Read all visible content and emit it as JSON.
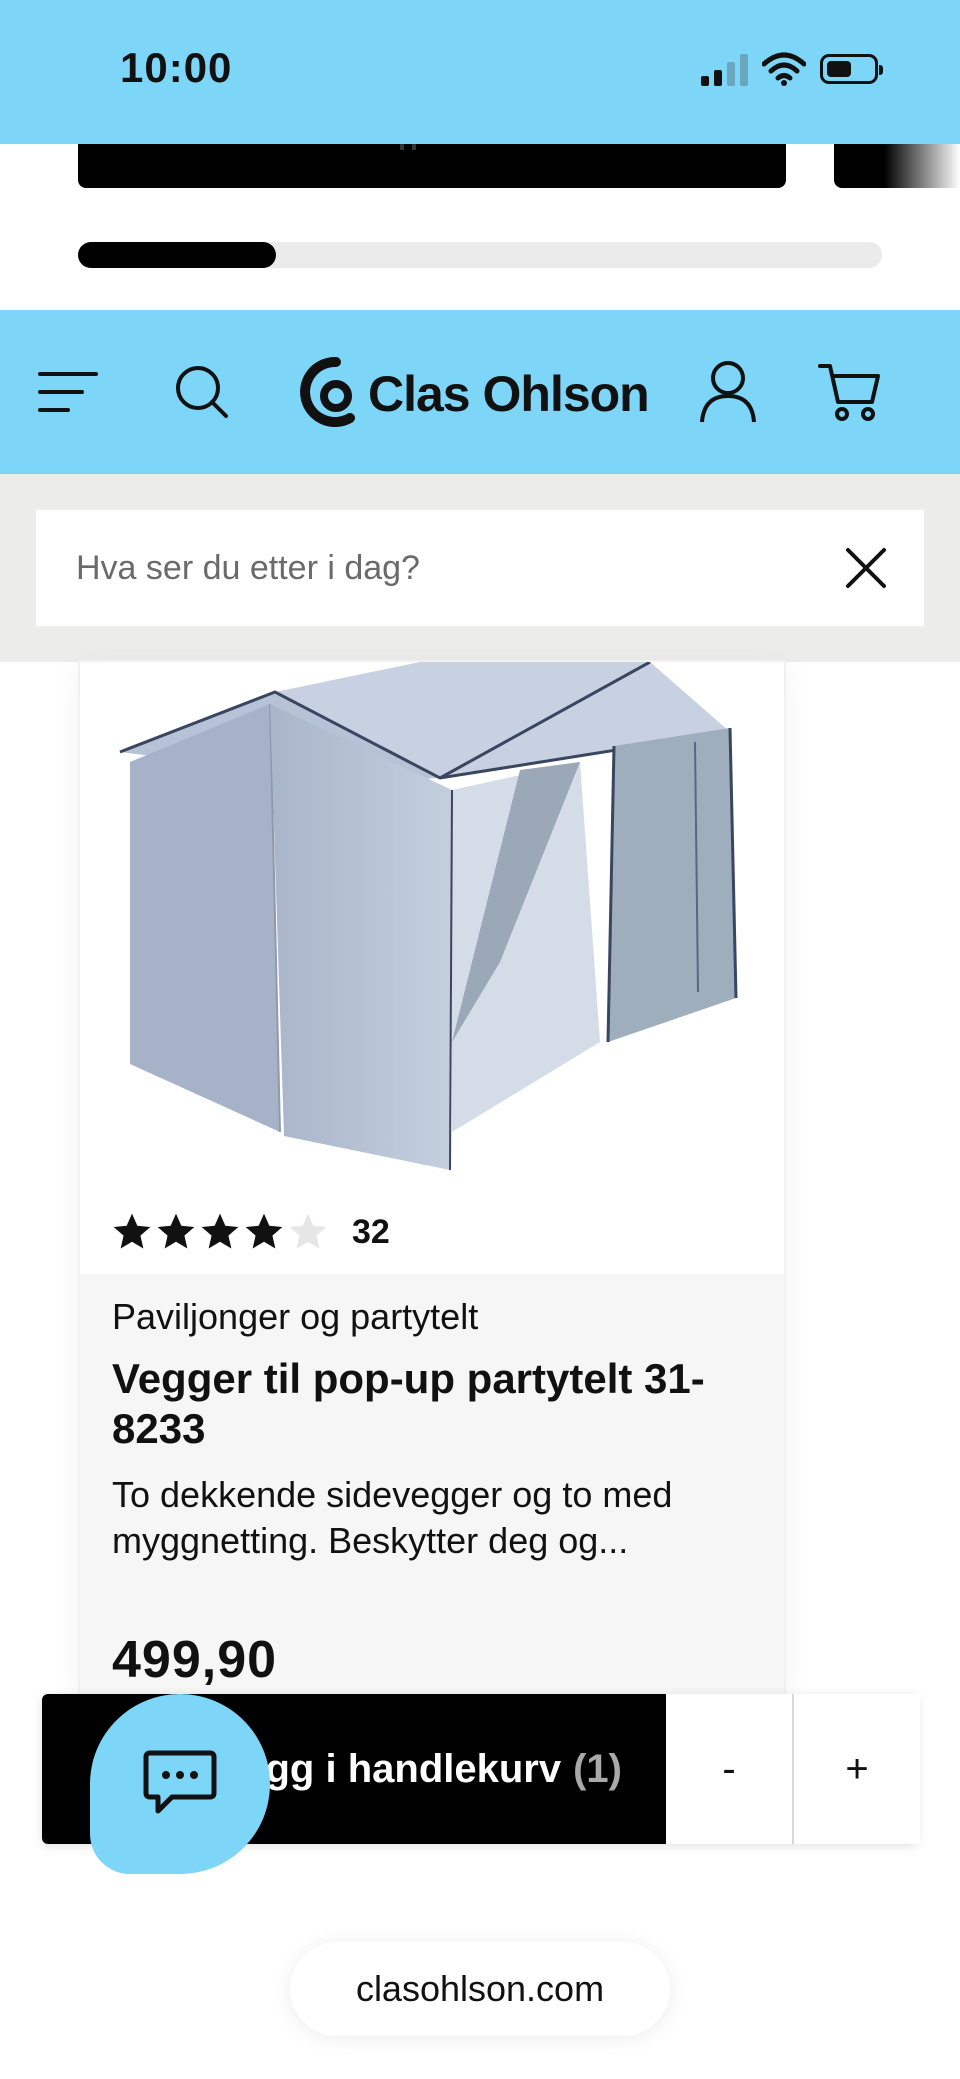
{
  "status_bar": {
    "time": "10:00"
  },
  "header": {
    "logo_text": "Clas Ohlson",
    "brand_color": "#7dd5f8",
    "icons": [
      "menu-icon",
      "search-icon",
      "user-icon",
      "cart-icon"
    ]
  },
  "search": {
    "placeholder": "Hva ser du etter i dag?",
    "value": ""
  },
  "product": {
    "rating_stars": 4,
    "rating_max": 5,
    "rating_count": "32",
    "category": "Paviljonger og partytelt",
    "title": "Vegger til pop-up partytelt 31-8233",
    "description": "To dekkende sidevegger og to med myggnetting. Beskytter deg og...",
    "price": "499,90"
  },
  "cart_bar": {
    "add_label": "Legg i handlekurv",
    "count": "(1)",
    "minus_label": "-",
    "plus_label": "+"
  },
  "browser": {
    "url": "clasohlson.com"
  }
}
